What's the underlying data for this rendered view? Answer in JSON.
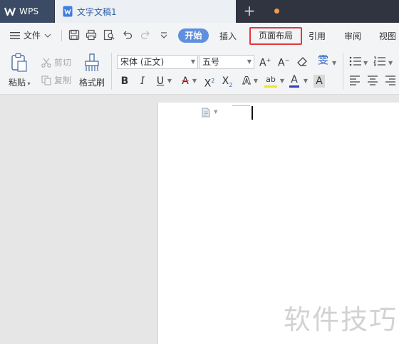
{
  "titlebar": {
    "app_tab": "WPS",
    "doc_tab": "文字文稿1",
    "new_tab_glyph": "+"
  },
  "menubar": {
    "file_label": "文件",
    "tabs": [
      "开始",
      "插入",
      "页面布局",
      "引用",
      "审阅",
      "视图"
    ],
    "active_tab": "开始",
    "highlighted_tab": "页面布局"
  },
  "ribbon": {
    "paste": "粘贴",
    "cut": "剪切",
    "copy": "复制",
    "format_painter": "格式刷",
    "font_name": "宋体 (正文)",
    "font_size": "五号",
    "pinyin_glyph": "雯"
  },
  "watermark": "软件技巧",
  "colors": {
    "title_bg": "#2f3440",
    "accent": "#5f8fe0",
    "highlight_border": "#e0393e",
    "modified_dot": "#f39b4b"
  }
}
